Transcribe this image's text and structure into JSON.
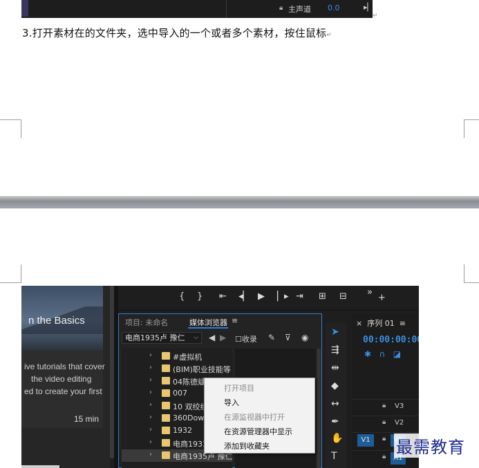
{
  "top_screenshot": {
    "lock_icon": "lock-icon",
    "master_channel_label": "主声道",
    "master_channel_value": "0.0",
    "end_icon": "step-forward-icon"
  },
  "document": {
    "step_text": "3.打开素材在的文件夹，选中导入的一个或者多个素材，按住鼠标",
    "paragraph_mark": "↵"
  },
  "premiere": {
    "learn_panel": {
      "hero_title": "n the Basics",
      "desc_lines": [
        "ive tutorials that cover",
        "the video editing",
        "ed to create your first"
      ],
      "duration": "15 min"
    },
    "transport_icons": [
      "mark-in-icon",
      "mark-out-icon",
      "go-to-in-icon",
      "step-back-icon",
      "play-icon",
      "step-forward-icon",
      "go-to-out-icon",
      "insert-icon",
      "overwrite-icon",
      "more-icon",
      "add-icon"
    ],
    "project_panel": {
      "tab_project": "项目: 未命名",
      "tab_media_browser": "媒体浏览器",
      "path_select": "电商1935卢 豫仁",
      "favorites_label": "收录",
      "folders": [
        "#虚拟机",
        "(BIM)职业技能等",
        "04陈德斌",
        "007",
        "10 双绞线",
        "360Downlo",
        "1932",
        "电商1931",
        "电商1935卢 豫仁"
      ]
    },
    "context_menu": {
      "items": [
        {
          "label": "打开项目",
          "disabled": true
        },
        {
          "label": "导入",
          "disabled": false
        },
        {
          "label": "在源监视器中打开",
          "disabled": true
        },
        {
          "label": "在资源管理器中显示",
          "disabled": false
        },
        {
          "label": "添加到收藏夹",
          "disabled": false
        }
      ]
    },
    "tools": [
      "selection-tool-icon",
      "track-select-icon",
      "ripple-edit-icon",
      "razor-icon",
      "slip-icon",
      "pen-icon",
      "hand-icon",
      "type-icon"
    ],
    "sequence": {
      "title": "序列 01",
      "close": "×",
      "timecode": "00:00:00:00",
      "tracks": [
        "V3",
        "V2",
        "V1"
      ],
      "v1_source": "V1",
      "a1": "A1"
    }
  },
  "watermark": "最需教育"
}
